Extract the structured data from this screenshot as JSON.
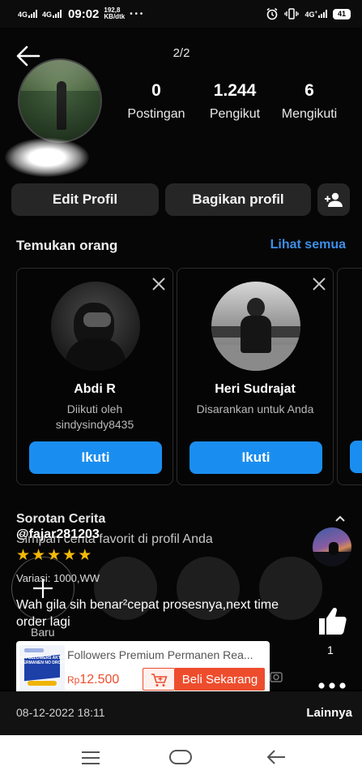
{
  "status_bar": {
    "net1": "4G",
    "net2": "4G",
    "time": "09:02",
    "speed_value": "192,8",
    "speed_unit": "KB/dtk",
    "dots": "• • •",
    "right_net": "4G",
    "right_net_sub": "+",
    "battery": "41"
  },
  "header": {
    "pager": "2/2"
  },
  "profile": {
    "stats": [
      {
        "value": "0",
        "label": "Postingan"
      },
      {
        "value": "1.244",
        "label": "Pengikut"
      },
      {
        "value": "6",
        "label": "Mengikuti"
      }
    ],
    "edit_button": "Edit Profil",
    "share_button": "Bagikan profil"
  },
  "suggestions": {
    "title": "Temukan orang",
    "see_all": "Lihat semua",
    "cards": [
      {
        "name": "Abdi R",
        "sub_line1": "Diikuti oleh",
        "sub_line2": "sindysindy8435",
        "button": "Ikuti"
      },
      {
        "name": "Heri Sudrajat",
        "sub_line1": "Disarankan untuk Anda",
        "sub_line2": "",
        "button": "Ikuti"
      }
    ]
  },
  "highlights": {
    "title": "Sorotan Cerita",
    "subtitle": "Simpan cerita favorit di profil Anda",
    "new_label": "Baru"
  },
  "review": {
    "username": "@fajar281203",
    "rating": 5,
    "variant": "Variasi: 1000,WW",
    "text": "Wah gila sih benar²cepat prosesnya,next time order lagi",
    "likes": "1",
    "date": "08-12-2022 18:11",
    "more_label": "Lainnya"
  },
  "ad": {
    "image_text": "#1 FOLLOWERS AKTIF PERMANEN NO DROP",
    "title": "Followers Premium Permanen Rea...",
    "price_currency": "Rp",
    "price": "12.500",
    "buy_button": "Beli Sekarang"
  },
  "colors": {
    "accent_blue": "#1a8ef0",
    "link_blue": "#3d8fe9",
    "shop_orange": "#ee4d2d",
    "star_gold": "#f5b90a"
  }
}
